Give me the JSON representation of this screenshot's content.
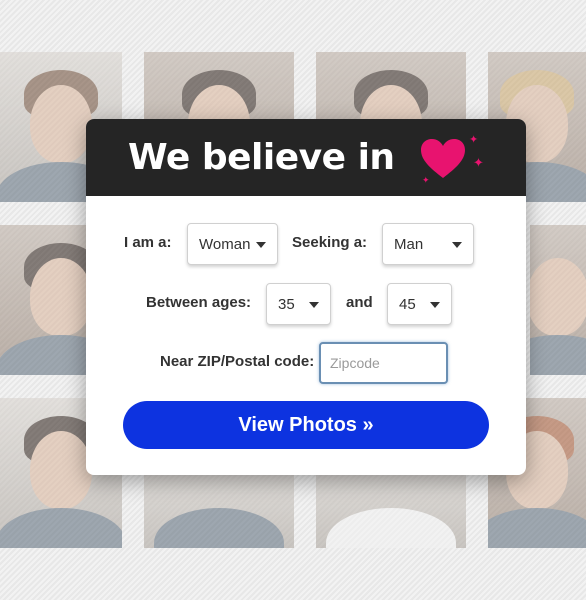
{
  "header": {
    "headline": "We believe in"
  },
  "form": {
    "gender_label": "I am a:",
    "gender_value": "Woman",
    "seeking_label": "Seeking a:",
    "seeking_value": "Man",
    "ages_label": "Between ages:",
    "age_min": "35",
    "ages_and": "and",
    "age_max": "45",
    "zip_label": "Near ZIP/Postal code:",
    "zip_placeholder": "Zipcode",
    "submit_label": "View Photos »"
  },
  "colors": {
    "accent": "#0d33e0",
    "heart": "#e8136f",
    "header_bg": "#252525"
  },
  "icons": [
    "heart-icon",
    "sparkle-icon",
    "chevron-down-icon"
  ]
}
